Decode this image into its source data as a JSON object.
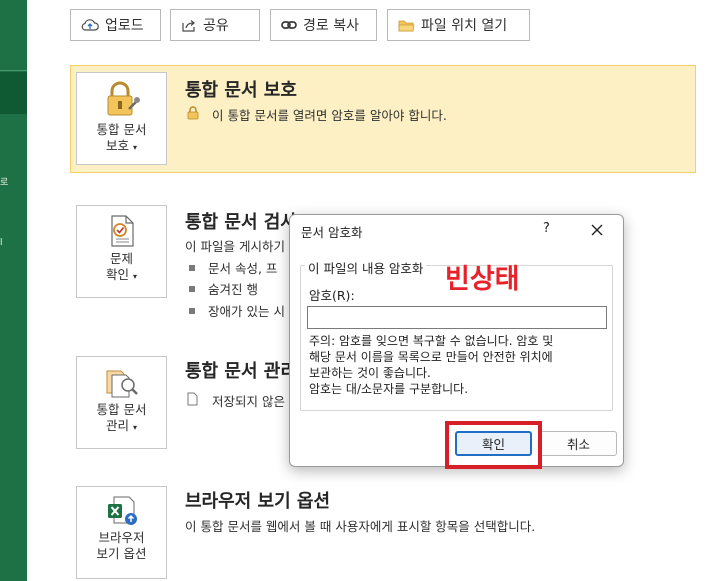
{
  "toolbar": {
    "upload": "업로드",
    "share": "공유",
    "copy_path": "경로 복사",
    "open_location": "파일 위치 열기"
  },
  "sidebar": {
    "fragments": [
      "로",
      "l"
    ]
  },
  "protect": {
    "button_line1": "통합 문서",
    "button_line2": "보호",
    "title": "통합 문서 보호",
    "desc": "이 통합 문서를 열려면 암호를 알아야 합니다."
  },
  "inspect": {
    "button_line1": "문제",
    "button_line2": "확인",
    "title": "통합 문서 검사",
    "desc": "이 파일을 게시하기",
    "bullets": [
      "문서 속성, 프",
      "숨겨진 행",
      "장애가 있는 시"
    ]
  },
  "manage": {
    "button_line1": "통합 문서",
    "button_line2": "관리",
    "title": "통합 문서 관리",
    "desc": "저장되지 않은"
  },
  "browser": {
    "button_line1": "브라우저",
    "button_line2": "보기 옵션",
    "title": "브라우저 보기 옵션",
    "desc": "이 통합 문서를 웹에서 볼 때 사용자에게 표시할 항목을 선택합니다."
  },
  "dialog": {
    "title": "문서 암호화",
    "help": "?",
    "group_title": "이 파일의 내용 암호화",
    "password_label": "암호(R):",
    "password_value": "",
    "warning": "주의: 암호를 잊으면 복구할 수 없습니다. 암호 및\n해당 문서 이름을 목록으로 만들어 안전한 위치에\n보관하는 것이 좋습니다.\n암호는 대/소문자를 구분합니다.",
    "ok": "확인",
    "cancel": "취소"
  },
  "annotation": {
    "label": "빈상태",
    "color": "#e8212b"
  },
  "colors": {
    "sidebar": "#1e7145",
    "highlight_bg": "#fdf0c4",
    "highlight_border": "#f2cf6a"
  }
}
